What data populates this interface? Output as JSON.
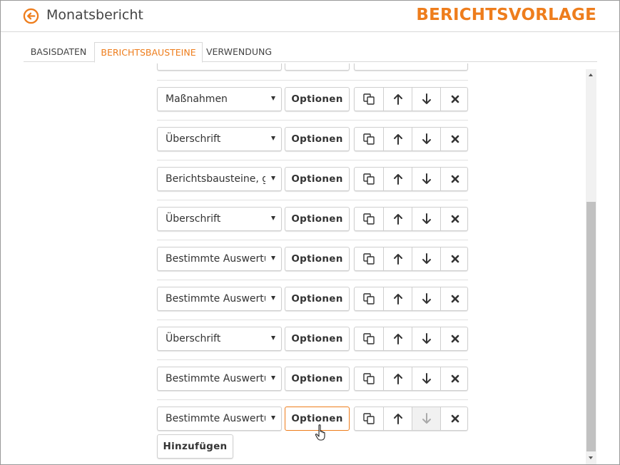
{
  "header": {
    "back_icon": "arrow-left-circle-icon",
    "title": "Monatsbericht",
    "brand": "BERICHTSVORLAGE",
    "accent_color": "#ee7d1c"
  },
  "tabs": [
    {
      "label": "BASISDATEN",
      "active": false
    },
    {
      "label": "BERICHTSBAUSTEINE",
      "active": true
    },
    {
      "label": "VERWENDUNG",
      "active": false
    }
  ],
  "rows": [
    {
      "select": "Maßnahmen",
      "options_label": "Optionen"
    },
    {
      "select": "Überschrift",
      "options_label": "Optionen"
    },
    {
      "select": "Berichtsbausteine, gruppiert",
      "options_label": "Optionen"
    },
    {
      "select": "Überschrift",
      "options_label": "Optionen"
    },
    {
      "select": "Bestimmte Auswertung",
      "options_label": "Optionen"
    },
    {
      "select": "Bestimmte Auswertung",
      "options_label": "Optionen"
    },
    {
      "select": "Überschrift",
      "options_label": "Optionen"
    },
    {
      "select": "Bestimmte Auswertung",
      "options_label": "Optionen"
    },
    {
      "select": "Bestimmte Auswertung",
      "options_label": "Optionen",
      "hover": true,
      "down_disabled": true
    }
  ],
  "row_actions": {
    "copy_icon": "copy-icon",
    "up_icon": "arrow-up-icon",
    "down_icon": "arrow-down-icon",
    "delete_icon": "close-icon"
  },
  "add_button": "Hinzufügen"
}
